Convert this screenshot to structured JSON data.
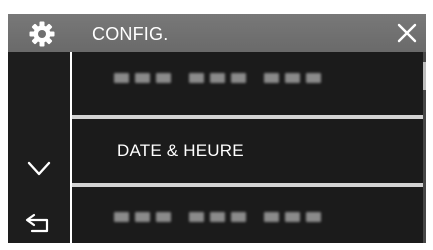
{
  "header": {
    "title": "CONFIG.",
    "settings_icon": "gear-icon",
    "close_icon": "close-icon"
  },
  "sidebar": {
    "down_icon": "chevron-down-icon",
    "back_icon": "back-arrow-icon"
  },
  "menu": {
    "items": [
      {
        "label": "",
        "obscured": true
      },
      {
        "label": "DATE & HEURE",
        "obscured": false
      },
      {
        "label": "",
        "obscured": true
      }
    ]
  },
  "colors": {
    "header_background": "#727272",
    "panel_background": "#1b1b1b",
    "divider": "#d3d3d3",
    "text": "#ffffff"
  }
}
